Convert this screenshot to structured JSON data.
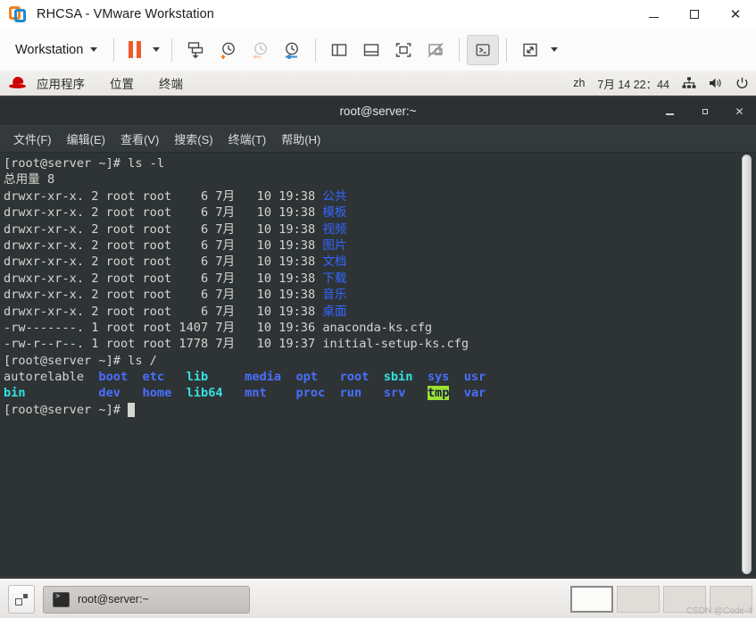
{
  "vmware": {
    "title": "RHCSA - VMware Workstation",
    "logo_icon": "vmware-logo-icon",
    "window_controls": [
      {
        "name": "minimize-button",
        "icon": "minimize-icon"
      },
      {
        "name": "maximize-button",
        "icon": "maximize-icon"
      },
      {
        "name": "close-button",
        "icon": "close-icon",
        "label": "✕"
      }
    ],
    "toolbar": {
      "menu_label": "Workstation",
      "buttons": [
        {
          "name": "pause-vm-button",
          "icon": "pause-icon"
        },
        {
          "name": "pause-dropdown-button",
          "icon": "chevron-down-icon"
        },
        {
          "name": "send-ctrl-alt-del-button",
          "icon": "send-key-icon"
        },
        {
          "name": "take-snapshot-button",
          "icon": "snapshot-add-icon"
        },
        {
          "name": "revert-snapshot-button",
          "icon": "snapshot-revert-icon"
        },
        {
          "name": "manage-snapshots-button",
          "icon": "snapshot-manage-icon"
        },
        {
          "name": "show-sidebar-button",
          "icon": "sidebar-panel-icon"
        },
        {
          "name": "show-thumbnail-bar-button",
          "icon": "bottom-panel-icon"
        },
        {
          "name": "full-screen-button",
          "icon": "fullscreen-icon"
        },
        {
          "name": "unity-mode-button",
          "icon": "unity-mode-icon"
        },
        {
          "name": "console-view-button",
          "icon": "console-terminal-icon"
        },
        {
          "name": "stretch-view-button",
          "icon": "expand-arrows-icon"
        },
        {
          "name": "stretch-dropdown-button",
          "icon": "chevron-down-icon"
        }
      ]
    }
  },
  "gnome_top": {
    "logo_icon": "red-hat-icon",
    "menus": [
      "应用程序",
      "位置",
      "终端"
    ],
    "keyboard_layout": "zh",
    "clock": "7月 14 22：44",
    "indicators": [
      {
        "name": "network-icon",
        "icon": "network-wired-icon"
      },
      {
        "name": "volume-icon",
        "icon": "speaker-icon"
      },
      {
        "name": "power-icon",
        "icon": "power-icon"
      }
    ]
  },
  "terminal": {
    "title": "root@server:~",
    "window_controls": [
      {
        "name": "terminal-minimize-button",
        "icon": "minimize-icon"
      },
      {
        "name": "terminal-maximize-button",
        "icon": "maximize-icon"
      },
      {
        "name": "terminal-close-button",
        "icon": "close-icon",
        "label": "✕"
      }
    ],
    "menus": [
      "文件(F)",
      "编辑(E)",
      "查看(V)",
      "搜索(S)",
      "终端(T)",
      "帮助(H)"
    ],
    "lines": [
      [
        {
          "t": "[root@server ~]# ls -l",
          "c": "white"
        }
      ],
      [
        {
          "t": "总用量 8",
          "c": "white"
        }
      ],
      [
        {
          "t": "drwxr-xr-x. 2 root root    6 7月   10 19:38 ",
          "c": "white"
        },
        {
          "t": "公共",
          "c": "blue"
        }
      ],
      [
        {
          "t": "drwxr-xr-x. 2 root root    6 7月   10 19:38 ",
          "c": "white"
        },
        {
          "t": "模板",
          "c": "blue"
        }
      ],
      [
        {
          "t": "drwxr-xr-x. 2 root root    6 7月   10 19:38 ",
          "c": "white"
        },
        {
          "t": "视频",
          "c": "blue"
        }
      ],
      [
        {
          "t": "drwxr-xr-x. 2 root root    6 7月   10 19:38 ",
          "c": "white"
        },
        {
          "t": "图片",
          "c": "blue"
        }
      ],
      [
        {
          "t": "drwxr-xr-x. 2 root root    6 7月   10 19:38 ",
          "c": "white"
        },
        {
          "t": "文档",
          "c": "blue"
        }
      ],
      [
        {
          "t": "drwxr-xr-x. 2 root root    6 7月   10 19:38 ",
          "c": "white"
        },
        {
          "t": "下载",
          "c": "blue"
        }
      ],
      [
        {
          "t": "drwxr-xr-x. 2 root root    6 7月   10 19:38 ",
          "c": "white"
        },
        {
          "t": "音乐",
          "c": "blue"
        }
      ],
      [
        {
          "t": "drwxr-xr-x. 2 root root    6 7月   10 19:38 ",
          "c": "white"
        },
        {
          "t": "桌面",
          "c": "blue"
        }
      ],
      [
        {
          "t": "-rw-------. 1 root root 1407 7月   10 19:36 anaconda-ks.cfg",
          "c": "white"
        }
      ],
      [
        {
          "t": "-rw-r--r--. 1 root root 1778 7月   10 19:37 initial-setup-ks.cfg",
          "c": "white"
        }
      ],
      [
        {
          "t": "[root@server ~]# ls /",
          "c": "white"
        }
      ],
      [
        {
          "t": "autorelable",
          "c": "white"
        },
        {
          "t": "  ",
          "c": "white"
        },
        {
          "t": "boot",
          "c": "blue-b"
        },
        {
          "t": "  ",
          "c": "white"
        },
        {
          "t": "etc",
          "c": "blue-b"
        },
        {
          "t": "   ",
          "c": "white"
        },
        {
          "t": "lib",
          "c": "cyan"
        },
        {
          "t": "     ",
          "c": "white"
        },
        {
          "t": "media",
          "c": "blue-b"
        },
        {
          "t": "  ",
          "c": "white"
        },
        {
          "t": "opt",
          "c": "blue-b"
        },
        {
          "t": "   ",
          "c": "white"
        },
        {
          "t": "root",
          "c": "blue-b"
        },
        {
          "t": "  ",
          "c": "white"
        },
        {
          "t": "sbin",
          "c": "cyan"
        },
        {
          "t": "  ",
          "c": "white"
        },
        {
          "t": "sys",
          "c": "blue-b"
        },
        {
          "t": "  ",
          "c": "white"
        },
        {
          "t": "usr",
          "c": "blue-b"
        }
      ],
      [
        {
          "t": "bin",
          "c": "cyan"
        },
        {
          "t": "        ",
          "c": "white"
        },
        {
          "t": "  ",
          "c": "white"
        },
        {
          "t": "dev",
          "c": "blue-b"
        },
        {
          "t": "   ",
          "c": "white"
        },
        {
          "t": "home",
          "c": "blue-b"
        },
        {
          "t": "  ",
          "c": "white"
        },
        {
          "t": "lib64",
          "c": "cyan"
        },
        {
          "t": "   ",
          "c": "white"
        },
        {
          "t": "mnt",
          "c": "blue-b"
        },
        {
          "t": "    ",
          "c": "white"
        },
        {
          "t": "proc",
          "c": "blue-b"
        },
        {
          "t": "  ",
          "c": "white"
        },
        {
          "t": "run",
          "c": "blue-b"
        },
        {
          "t": "   ",
          "c": "white"
        },
        {
          "t": "srv",
          "c": "blue-b"
        },
        {
          "t": "   ",
          "c": "white"
        },
        {
          "t": "tmp",
          "c": "hl"
        },
        {
          "t": "  ",
          "c": "white"
        },
        {
          "t": "var",
          "c": "blue-b"
        }
      ],
      [
        {
          "t": "[root@server ~]# ",
          "c": "white"
        }
      ]
    ]
  },
  "gnome_bottom": {
    "show_desktop_icon": "show-desktop-icon",
    "task": {
      "icon": "terminal-icon",
      "label": "root@server:~"
    },
    "workspaces": [
      {
        "name": "workspace-1",
        "active": true
      },
      {
        "name": "workspace-2",
        "active": false
      },
      {
        "name": "workspace-3",
        "active": false
      },
      {
        "name": "workspace-4",
        "active": false
      }
    ],
    "watermark": "CSDN @Code-4"
  }
}
